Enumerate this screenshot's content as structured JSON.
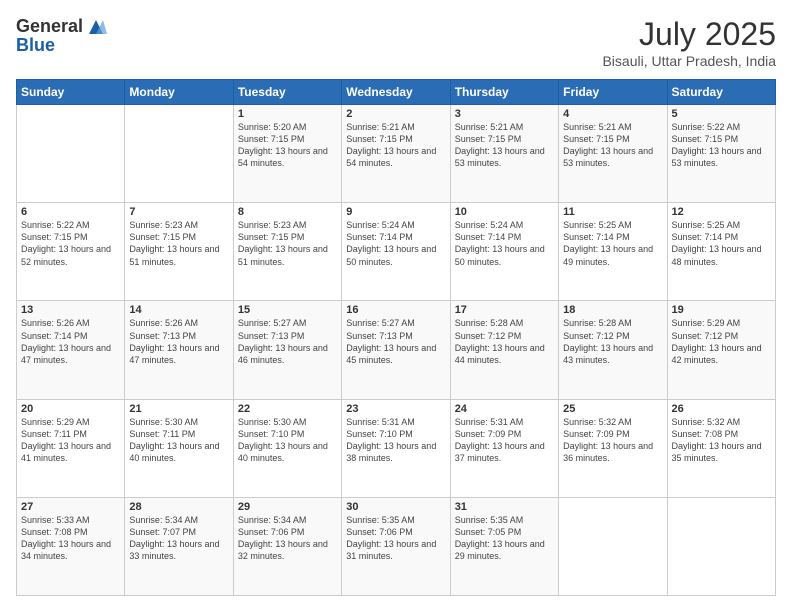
{
  "header": {
    "logo_general": "General",
    "logo_blue": "Blue",
    "month_year": "July 2025",
    "location": "Bisauli, Uttar Pradesh, India"
  },
  "calendar": {
    "headers": [
      "Sunday",
      "Monday",
      "Tuesday",
      "Wednesday",
      "Thursday",
      "Friday",
      "Saturday"
    ],
    "weeks": [
      [
        {
          "day": "",
          "info": ""
        },
        {
          "day": "",
          "info": ""
        },
        {
          "day": "1",
          "info": "Sunrise: 5:20 AM\nSunset: 7:15 PM\nDaylight: 13 hours and 54 minutes."
        },
        {
          "day": "2",
          "info": "Sunrise: 5:21 AM\nSunset: 7:15 PM\nDaylight: 13 hours and 54 minutes."
        },
        {
          "day": "3",
          "info": "Sunrise: 5:21 AM\nSunset: 7:15 PM\nDaylight: 13 hours and 53 minutes."
        },
        {
          "day": "4",
          "info": "Sunrise: 5:21 AM\nSunset: 7:15 PM\nDaylight: 13 hours and 53 minutes."
        },
        {
          "day": "5",
          "info": "Sunrise: 5:22 AM\nSunset: 7:15 PM\nDaylight: 13 hours and 53 minutes."
        }
      ],
      [
        {
          "day": "6",
          "info": "Sunrise: 5:22 AM\nSunset: 7:15 PM\nDaylight: 13 hours and 52 minutes."
        },
        {
          "day": "7",
          "info": "Sunrise: 5:23 AM\nSunset: 7:15 PM\nDaylight: 13 hours and 51 minutes."
        },
        {
          "day": "8",
          "info": "Sunrise: 5:23 AM\nSunset: 7:15 PM\nDaylight: 13 hours and 51 minutes."
        },
        {
          "day": "9",
          "info": "Sunrise: 5:24 AM\nSunset: 7:14 PM\nDaylight: 13 hours and 50 minutes."
        },
        {
          "day": "10",
          "info": "Sunrise: 5:24 AM\nSunset: 7:14 PM\nDaylight: 13 hours and 50 minutes."
        },
        {
          "day": "11",
          "info": "Sunrise: 5:25 AM\nSunset: 7:14 PM\nDaylight: 13 hours and 49 minutes."
        },
        {
          "day": "12",
          "info": "Sunrise: 5:25 AM\nSunset: 7:14 PM\nDaylight: 13 hours and 48 minutes."
        }
      ],
      [
        {
          "day": "13",
          "info": "Sunrise: 5:26 AM\nSunset: 7:14 PM\nDaylight: 13 hours and 47 minutes."
        },
        {
          "day": "14",
          "info": "Sunrise: 5:26 AM\nSunset: 7:13 PM\nDaylight: 13 hours and 47 minutes."
        },
        {
          "day": "15",
          "info": "Sunrise: 5:27 AM\nSunset: 7:13 PM\nDaylight: 13 hours and 46 minutes."
        },
        {
          "day": "16",
          "info": "Sunrise: 5:27 AM\nSunset: 7:13 PM\nDaylight: 13 hours and 45 minutes."
        },
        {
          "day": "17",
          "info": "Sunrise: 5:28 AM\nSunset: 7:12 PM\nDaylight: 13 hours and 44 minutes."
        },
        {
          "day": "18",
          "info": "Sunrise: 5:28 AM\nSunset: 7:12 PM\nDaylight: 13 hours and 43 minutes."
        },
        {
          "day": "19",
          "info": "Sunrise: 5:29 AM\nSunset: 7:12 PM\nDaylight: 13 hours and 42 minutes."
        }
      ],
      [
        {
          "day": "20",
          "info": "Sunrise: 5:29 AM\nSunset: 7:11 PM\nDaylight: 13 hours and 41 minutes."
        },
        {
          "day": "21",
          "info": "Sunrise: 5:30 AM\nSunset: 7:11 PM\nDaylight: 13 hours and 40 minutes."
        },
        {
          "day": "22",
          "info": "Sunrise: 5:30 AM\nSunset: 7:10 PM\nDaylight: 13 hours and 40 minutes."
        },
        {
          "day": "23",
          "info": "Sunrise: 5:31 AM\nSunset: 7:10 PM\nDaylight: 13 hours and 38 minutes."
        },
        {
          "day": "24",
          "info": "Sunrise: 5:31 AM\nSunset: 7:09 PM\nDaylight: 13 hours and 37 minutes."
        },
        {
          "day": "25",
          "info": "Sunrise: 5:32 AM\nSunset: 7:09 PM\nDaylight: 13 hours and 36 minutes."
        },
        {
          "day": "26",
          "info": "Sunrise: 5:32 AM\nSunset: 7:08 PM\nDaylight: 13 hours and 35 minutes."
        }
      ],
      [
        {
          "day": "27",
          "info": "Sunrise: 5:33 AM\nSunset: 7:08 PM\nDaylight: 13 hours and 34 minutes."
        },
        {
          "day": "28",
          "info": "Sunrise: 5:34 AM\nSunset: 7:07 PM\nDaylight: 13 hours and 33 minutes."
        },
        {
          "day": "29",
          "info": "Sunrise: 5:34 AM\nSunset: 7:06 PM\nDaylight: 13 hours and 32 minutes."
        },
        {
          "day": "30",
          "info": "Sunrise: 5:35 AM\nSunset: 7:06 PM\nDaylight: 13 hours and 31 minutes."
        },
        {
          "day": "31",
          "info": "Sunrise: 5:35 AM\nSunset: 7:05 PM\nDaylight: 13 hours and 29 minutes."
        },
        {
          "day": "",
          "info": ""
        },
        {
          "day": "",
          "info": ""
        }
      ]
    ]
  }
}
